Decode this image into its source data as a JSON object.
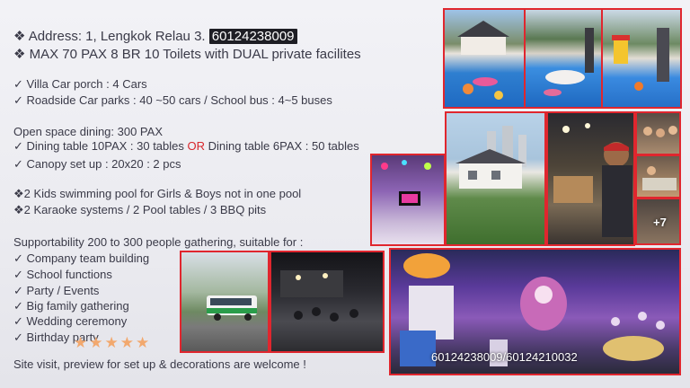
{
  "listing": {
    "address_prefix": "❖ Address: 1, Lengkok Relau 3.",
    "address_phone": "60124238009",
    "capacity": "❖ MAX 70 PAX 8 BR 10 Toilets with DUAL private facilites",
    "parking": [
      "✓   Villa Car porch : 4 Cars",
      "✓   Roadside Car parks : 40 ~50 cars / School bus : 4~5 buses"
    ],
    "dining_heading": "Open space dining: 300 PAX",
    "dining_table_a": "✓   Dining table 10PAX : 30 tables ",
    "dining_or": "OR",
    "dining_table_b": " Dining table 6PAX : 50 tables",
    "canopy": "✓   Canopy set up : 20x20 : 2 pcs",
    "facilities": [
      "❖2 Kids swimming pool for Girls & Boys not in one pool",
      "❖2 Karaoke systems / 2 Pool tables / 3 BBQ pits"
    ],
    "supportability": "Supportability 200 to 300 people gathering, suitable for :",
    "events": [
      "✓   Company team building",
      "✓   School functions",
      "✓   Party / Events",
      "✓   Big family gathering",
      "✓   Wedding ceremony",
      "✓   Birthday party"
    ],
    "stars": "★★★★★",
    "footer": "Site visit, preview for set up & decorations are welcome !",
    "photo_caption": "60124238009/60124210032",
    "more_photos": "+7"
  },
  "colors": {
    "frame": "#e0262e",
    "text": "#3a3a48",
    "highlight_or": "#d7272c"
  }
}
